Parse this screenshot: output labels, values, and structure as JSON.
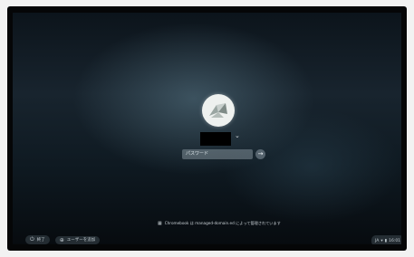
{
  "login": {
    "password_placeholder": "パスワード",
    "submit_glyph": "→",
    "chevron_glyph": "⌄"
  },
  "notice": {
    "text": "Chromebook は managed-domain.ed によって管理されています"
  },
  "shelf": {
    "shutdown_label": "終了",
    "add_user_label": "ユーザーを追加"
  },
  "status": {
    "ime": "JA",
    "time": "16:01"
  }
}
